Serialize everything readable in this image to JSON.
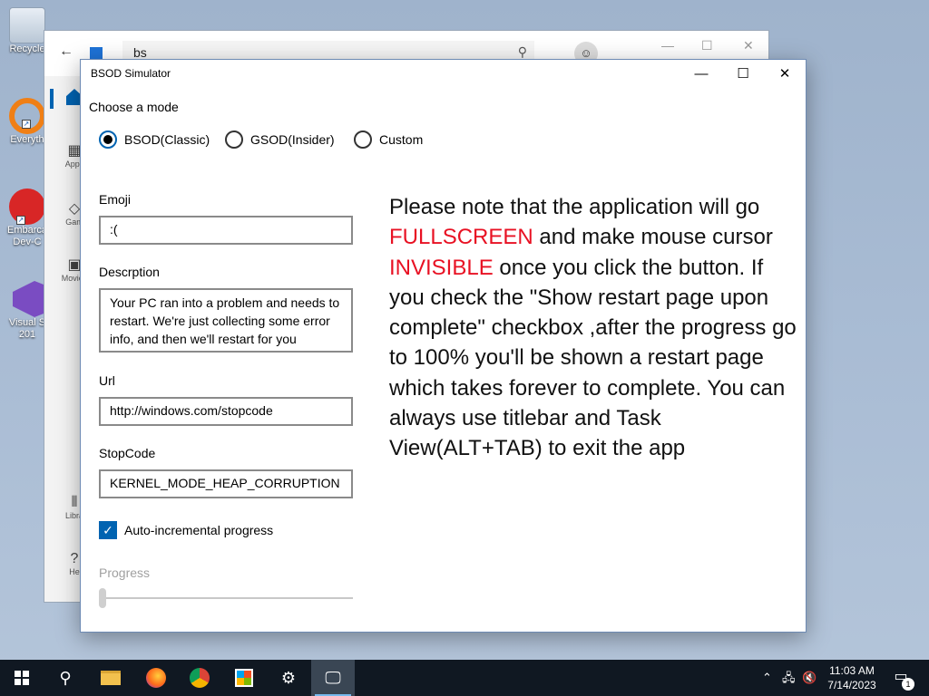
{
  "desktop": {
    "icons": [
      {
        "label": "Recycle"
      },
      {
        "label": "Everyth"
      },
      {
        "label": "Embarca Dev-C"
      },
      {
        "label": "Visual S 201"
      }
    ]
  },
  "store": {
    "search_value": "bs",
    "side_items": [
      {
        "label": "Apps"
      },
      {
        "label": "Gam"
      },
      {
        "label": "Movies"
      },
      {
        "label": "Libra"
      },
      {
        "label": "He"
      }
    ]
  },
  "app": {
    "title": "BSOD Simulator",
    "mode_label": "Choose a mode",
    "modes": [
      {
        "label": "BSOD(Classic)",
        "selected": true
      },
      {
        "label": "GSOD(Insider)",
        "selected": false
      },
      {
        "label": "Custom",
        "selected": false
      }
    ],
    "fields": {
      "emoji_label": "Emoji",
      "emoji_value": ":(",
      "description_label": "Descrption",
      "description_value": "Your PC ran into a problem and needs to restart. We're just collecting some error info, and then we'll restart for you",
      "url_label": "Url",
      "url_value": "http://windows.com/stopcode",
      "stopcode_label": "StopCode",
      "stopcode_value": "KERNEL_MODE_HEAP_CORRUPTION"
    },
    "auto_progress_label": "Auto-incremental progress",
    "auto_progress_checked": true,
    "progress_label": "Progress",
    "progress_value": 0,
    "note": {
      "part1": "Please note that the application will go ",
      "red1": "FULLSCREEN",
      "part2": " and make mouse cursor ",
      "red2": "INVISIBLE",
      "part3": " once you click the button. If you check the \"Show restart page upon complete\" checkbox ,after the progress go to 100% you'll be shown a restart page which takes forever to complete. You can always use titlebar and Task View(ALT+TAB) to exit the app"
    },
    "accent_color": "#0063b1",
    "warning_color": "#e81123"
  },
  "taskbar": {
    "time": "11:03 AM",
    "date": "7/14/2023",
    "notification_count": "1"
  }
}
